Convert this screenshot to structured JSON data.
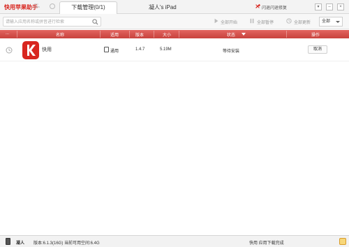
{
  "titlebar": {
    "brand": "快用苹果助手",
    "brand_sub": "pro\nbeta",
    "tab_label": "下载管理(0/1)",
    "device_title": "凝人's iPad",
    "repair_label": "闪退闪退修复",
    "menu_glyph": "▾",
    "min_glyph": "–",
    "close_glyph": "×"
  },
  "toolbar": {
    "search_placeholder": "请输入应用名称或拼音进行检索",
    "start_all": "全部开始",
    "pause_all": "全部暂停",
    "remove_all": "全部更新",
    "filter_value": "全部"
  },
  "table": {
    "headers": {
      "name": "名称",
      "applicable": "适用",
      "version": "版本",
      "size": "大小",
      "status": "状态",
      "action": "操作"
    },
    "rows": [
      {
        "name": "快用",
        "applicable": "通用",
        "version": "1.4.7",
        "size": "5.19M",
        "status": "等待安装",
        "action": "取消"
      }
    ]
  },
  "statusbar": {
    "device_name": "凝人",
    "version_info": "版本:6.1.3(16G)  当前可用空间:6.4G",
    "app_status": "快用 应用下载完成"
  },
  "colors": {
    "brand": "#d8261f",
    "header_red": "#d9534f"
  }
}
